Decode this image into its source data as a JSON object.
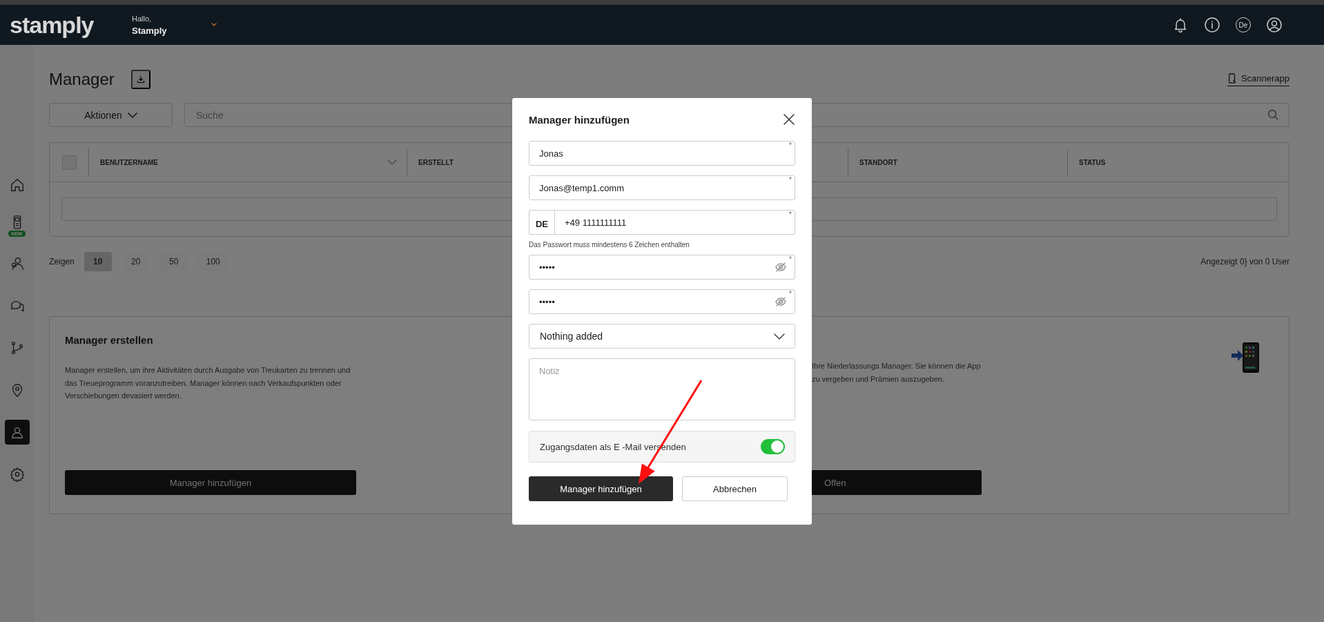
{
  "header": {
    "logo": "stamply",
    "greeting": "Hallo,",
    "user_name": "Stamply",
    "language": "De"
  },
  "sidebar": {
    "items": [
      {
        "selected": false
      },
      {
        "selected": false,
        "badge": "NEW"
      },
      {
        "selected": false
      },
      {
        "selected": false
      },
      {
        "selected": false
      },
      {
        "selected": false
      },
      {
        "selected": true
      },
      {
        "selected": false
      }
    ]
  },
  "page": {
    "title": "Manager",
    "scanner_link": "Scannerapp"
  },
  "toolbar": {
    "actions_label": "Aktionen",
    "search": {
      "placeholder": "Suche"
    }
  },
  "table": {
    "select_all_checked": false,
    "columns": [
      {
        "label": "BENUTZERNAME",
        "sortable": true
      },
      {
        "label": "ERSTELLT",
        "sortable": false
      },
      {
        "label": "STANDORT",
        "sortable": false
      },
      {
        "label": "STATUS",
        "sortable": false
      }
    ]
  },
  "pagination": {
    "label": "Zeigen",
    "sizes": [
      {
        "label": "10",
        "selected": true
      },
      {
        "label": "20",
        "selected": false
      },
      {
        "label": "50",
        "selected": false
      },
      {
        "label": "100",
        "selected": false
      }
    ],
    "summary": "Angezeigt 0} von 0 User"
  },
  "create_card": {
    "title": "Manager erstellen",
    "text": "Manager erstellen, um ihre Aktivitäten durch Ausgabe von Treukarten zu trennen und das Treueprogramm voranzutreiben. Manager können nach Verkaufspunkten oder Verschiebungen devasiert werden.",
    "button": "Manager hinzufügen"
  },
  "app_card": {
    "text_lines": [
      "Ihre Niederlassungs Manager. Sie können die App",
      "zu vergeben und Prämien auszugeben."
    ],
    "button": "Offen"
  },
  "modal": {
    "title": "Manager hinzufügen",
    "required_mark": "*",
    "fields": [
      {
        "kind": "text",
        "value": "Jonas",
        "required": true
      },
      {
        "kind": "text",
        "value": "Jonas@temp1.comm",
        "required": true
      },
      {
        "kind": "phone",
        "country": "DE",
        "value": "+49 1111111111",
        "required": true
      },
      {
        "kind": "hint",
        "text": "Das Passwort muss mindestens 6 Zeichen enthalten"
      },
      {
        "kind": "password",
        "value": "•••••",
        "required": true
      },
      {
        "kind": "password",
        "value": "•••••",
        "required": true
      },
      {
        "kind": "select",
        "value": "Nothing added"
      },
      {
        "kind": "textarea",
        "placeholder": "Notiz"
      },
      {
        "kind": "toggle",
        "label": "Zugangsdaten als E -Mail versenden",
        "on": true
      }
    ],
    "buttons": [
      {
        "kind": "primary",
        "label": "Manager hinzufügen"
      },
      {
        "kind": "secondary",
        "label": "Abbrechen"
      }
    ]
  }
}
